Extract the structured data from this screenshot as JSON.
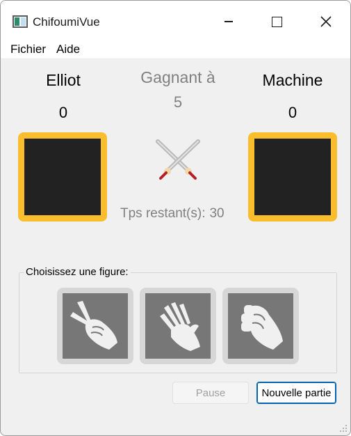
{
  "window": {
    "title": "ChifoumiVue"
  },
  "menu": {
    "items": [
      "Fichier",
      "Aide"
    ]
  },
  "players": {
    "left": {
      "name": "Elliot",
      "score": "0"
    },
    "right": {
      "name": "Machine",
      "score": "0"
    }
  },
  "winning": {
    "label": "Gagnant à",
    "value": "5"
  },
  "timer": {
    "label": "Tps restant(s):",
    "value": "30"
  },
  "figures": {
    "group_label": "Choisissez une figure:",
    "items": [
      {
        "icon": "scissors-hand-icon"
      },
      {
        "icon": "paper-hand-icon"
      },
      {
        "icon": "rock-fist-icon"
      }
    ]
  },
  "buttons": {
    "pause": "Pause",
    "new_game": "Nouvelle partie"
  },
  "colors": {
    "choice_frame": "#f9bd2e",
    "choice_fill": "#222222",
    "figure_tile": "#777777",
    "accent_border": "#0063b1"
  }
}
